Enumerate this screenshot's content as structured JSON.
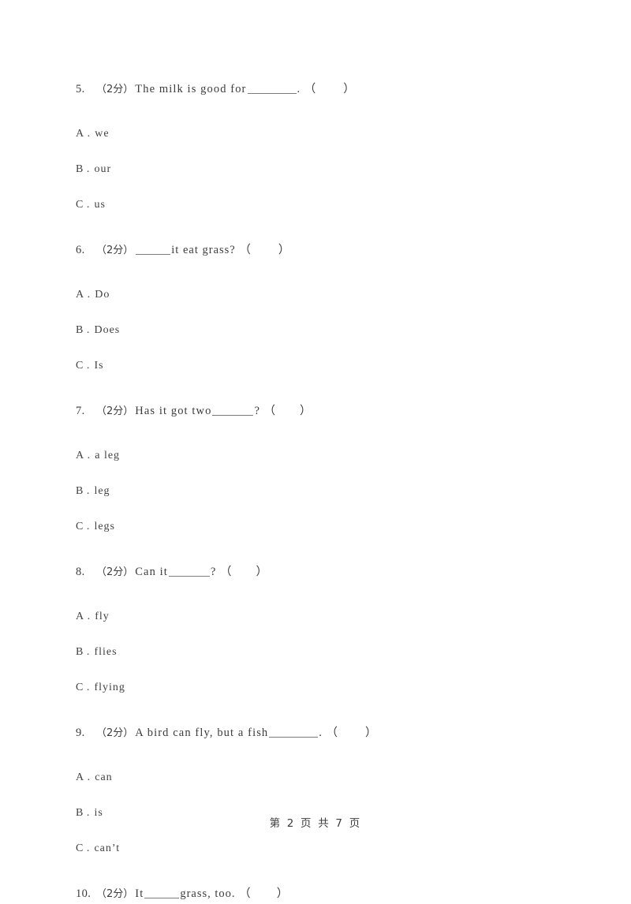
{
  "document": {
    "type": "exam-paper",
    "footer": "第 2 页 共 7 页",
    "score_label": "（2分）"
  },
  "questions": [
    {
      "number": "5.",
      "score": "（2分）",
      "text_before": "The milk is good for ",
      "blank": "long",
      "text_after": ". （",
      "paren_close": "）",
      "options": [
        {
          "letter": "A",
          "dot": ".",
          "text": "we"
        },
        {
          "letter": "B",
          "dot": ".",
          "text": "our"
        },
        {
          "letter": "C",
          "dot": ".",
          "text": "us"
        }
      ]
    },
    {
      "number": "6.",
      "score": "（2分）",
      "text_before": "",
      "blank": "short",
      "text_after": " it eat grass?  （",
      "paren_close": "）",
      "options": [
        {
          "letter": "A",
          "dot": ".",
          "text": "Do"
        },
        {
          "letter": "B",
          "dot": ".",
          "text": "Does"
        },
        {
          "letter": "C",
          "dot": ".",
          "text": "Is"
        }
      ]
    },
    {
      "number": "7.",
      "score": "（2分）",
      "text_before": "Has it got two ",
      "blank": "mid",
      "text_after": "? （",
      "paren_close": "）",
      "options": [
        {
          "letter": "A",
          "dot": ".",
          "text": "a leg"
        },
        {
          "letter": "B",
          "dot": ".",
          "text": "leg"
        },
        {
          "letter": "C",
          "dot": ".",
          "text": "legs"
        }
      ]
    },
    {
      "number": "8.",
      "score": "（2分）",
      "text_before": "Can it ",
      "blank": "mid",
      "text_after": "? （",
      "paren_close": "）",
      "options": [
        {
          "letter": "A",
          "dot": ".",
          "text": "fly"
        },
        {
          "letter": "B",
          "dot": ".",
          "text": "flies"
        },
        {
          "letter": "C",
          "dot": ".",
          "text": "flying"
        }
      ]
    },
    {
      "number": "9.",
      "score": "（2分）",
      "text_before": "A bird can fly, but a fish ",
      "blank": "long",
      "text_after": ". （",
      "paren_close": "）",
      "options": [
        {
          "letter": "A",
          "dot": ".",
          "text": "can"
        },
        {
          "letter": "B",
          "dot": ".",
          "text": "is"
        },
        {
          "letter": "C",
          "dot": ".",
          "text": "can’t"
        }
      ]
    },
    {
      "number": "10.",
      "score": "（2分）",
      "text_before": "It ",
      "blank": "short",
      "text_after": " grass, too.  （",
      "paren_close": "）",
      "options": []
    }
  ]
}
